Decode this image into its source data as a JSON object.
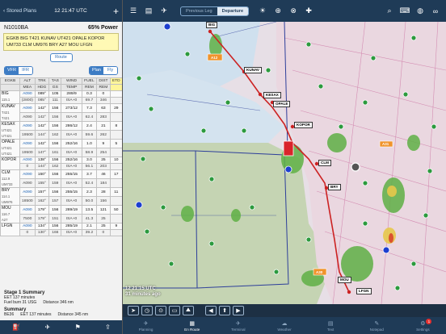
{
  "left_panel": {
    "back_label": "Stored Plans",
    "time": "12 21:47 UTC",
    "add_label": "+",
    "registration": "N1010BA",
    "power": "65% Power",
    "route_text": "EGKB BIG T421 KUNAV UT421 OPALE KOPOR UM733 CLM UM976 BRY A27 MOU LFGN",
    "route_button": "Route",
    "rules": [
      "VFR",
      "IFR"
    ],
    "modes": [
      "Plan",
      "Fly"
    ],
    "headers_row1": [
      "EGKB",
      "ALT",
      "TRK",
      "TAS",
      "WIND",
      "FUEL",
      "DIST",
      "ETD"
    ],
    "headers_row2": [
      "",
      "MEA",
      "HDG",
      "GS",
      "TEMP",
      "REM",
      "REM",
      ""
    ],
    "rows": [
      {
        "wpt": "BIG",
        "sub": "115.1",
        "r1": [
          "A090",
          "089°",
          "105",
          "289/9",
          "0.3",
          "0",
          ""
        ],
        "r2": [
          "(2800)",
          "085°",
          "111",
          "ISA+0",
          "69.7",
          "346",
          ""
        ]
      },
      {
        "wpt": "KUNAV",
        "sub": "T421",
        "r1": [
          "A090",
          "142°",
          "156",
          "273/12",
          "7.3",
          "63",
          "29"
        ],
        "r2": [
          "A090",
          "142°",
          "156",
          "ISA+0",
          "62.4",
          "283",
          ""
        ]
      },
      {
        "wpt": "KESAX",
        "sub": "UT421",
        "r1": [
          "A090",
          "142°",
          "156",
          "286/12",
          "2.4",
          "21",
          "8"
        ],
        "r2": [
          "19500",
          "144°",
          "162",
          "ISA+0",
          "59.6",
          "262",
          ""
        ]
      },
      {
        "wpt": "OPALE",
        "sub": "UT421",
        "r1": [
          "A090",
          "142°",
          "156",
          "252/16",
          "1.0",
          "9",
          "5"
        ],
        "r2": [
          "19500",
          "147°",
          "161",
          "ISA+0",
          "58.9",
          "254",
          ""
        ]
      },
      {
        "wpt": "KOPOR",
        "sub": "",
        "r1": [
          "A090",
          "138°",
          "156",
          "252/16",
          "3.0",
          "25",
          "10"
        ],
        "r2": [
          "0",
          "144°",
          "162",
          "ISA+0",
          "56.1",
          "203",
          ""
        ]
      },
      {
        "wpt": "CLM",
        "sub": "112.9",
        "r1": [
          "A090",
          "150°",
          "156",
          "255/15",
          "3.7",
          "46",
          "17"
        ],
        "r2": [
          "A090",
          "155°",
          "159",
          "ISA+0",
          "52.4",
          "184",
          ""
        ]
      },
      {
        "wpt": "BRY",
        "sub": "114.1",
        "r1": [
          "A090",
          "157°",
          "156",
          "255/15",
          "2.3",
          "28",
          "11"
        ],
        "r2": [
          "18500",
          "162°",
          "157",
          "ISA+0",
          "50.0",
          "156",
          ""
        ]
      },
      {
        "wpt": "MOU",
        "sub": "116.7",
        "r1": [
          "A090",
          "179°",
          "156",
          "289/19",
          "13.5",
          "121",
          "50"
        ],
        "r2": [
          "7500",
          "179°",
          "151",
          "ISA+0",
          "41.3",
          "25",
          ""
        ]
      },
      {
        "wpt": "LFGN",
        "sub": "",
        "r1": [
          "A090",
          "134°",
          "156",
          "285/19",
          "2.1",
          "25",
          "9"
        ],
        "r2": [
          "0",
          "130°",
          "166",
          "ISA+0",
          "39.2",
          "0",
          ""
        ]
      }
    ],
    "row_subs2": [
      "",
      "T421",
      "UT421",
      "UT421",
      "",
      "UM733",
      "UM976",
      "A27",
      ""
    ],
    "summary_title": "Stage 1 Summary",
    "summary_ete": "EET 137 minutes",
    "summary_fuel": "Fuel burn 31 USG",
    "summary_dist": "Distance 346 nm",
    "summary2_title": "Summary",
    "summary2_eet": "EET 137 minutes",
    "summary2_dist": "Distance 345 nm",
    "summary2_left": "BE36"
  },
  "toolbar": {
    "prev_leg": "Previous Leg",
    "departure": "Departure"
  },
  "map": {
    "labels": [
      "BIG",
      "KUNAV",
      "KESAX",
      "OPALE",
      "KOPOR",
      "CLM",
      "BRY",
      "MOU",
      "LFGN"
    ],
    "time_line1": "12 21:15 UTC",
    "time_line2": "31 minutes ago",
    "flag_labels": [
      "A12",
      "A30",
      "A31"
    ],
    "colors": {
      "route": "#cc2222",
      "airspace": "#2e3f9a",
      "terrain": "#c8d6b4",
      "water": "#c9dceb"
    }
  },
  "tabs": [
    {
      "label": "Planning",
      "icon": "planning-icon"
    },
    {
      "label": "En Route",
      "icon": "enroute-icon"
    },
    {
      "label": "Terminal",
      "icon": "terminal-icon"
    },
    {
      "label": "Weather",
      "icon": "weather-icon"
    },
    {
      "label": "Text",
      "icon": "text-icon"
    },
    {
      "label": "Notepad",
      "icon": "notepad-icon"
    },
    {
      "label": "Settings",
      "icon": "settings-icon",
      "badge": "1"
    }
  ]
}
